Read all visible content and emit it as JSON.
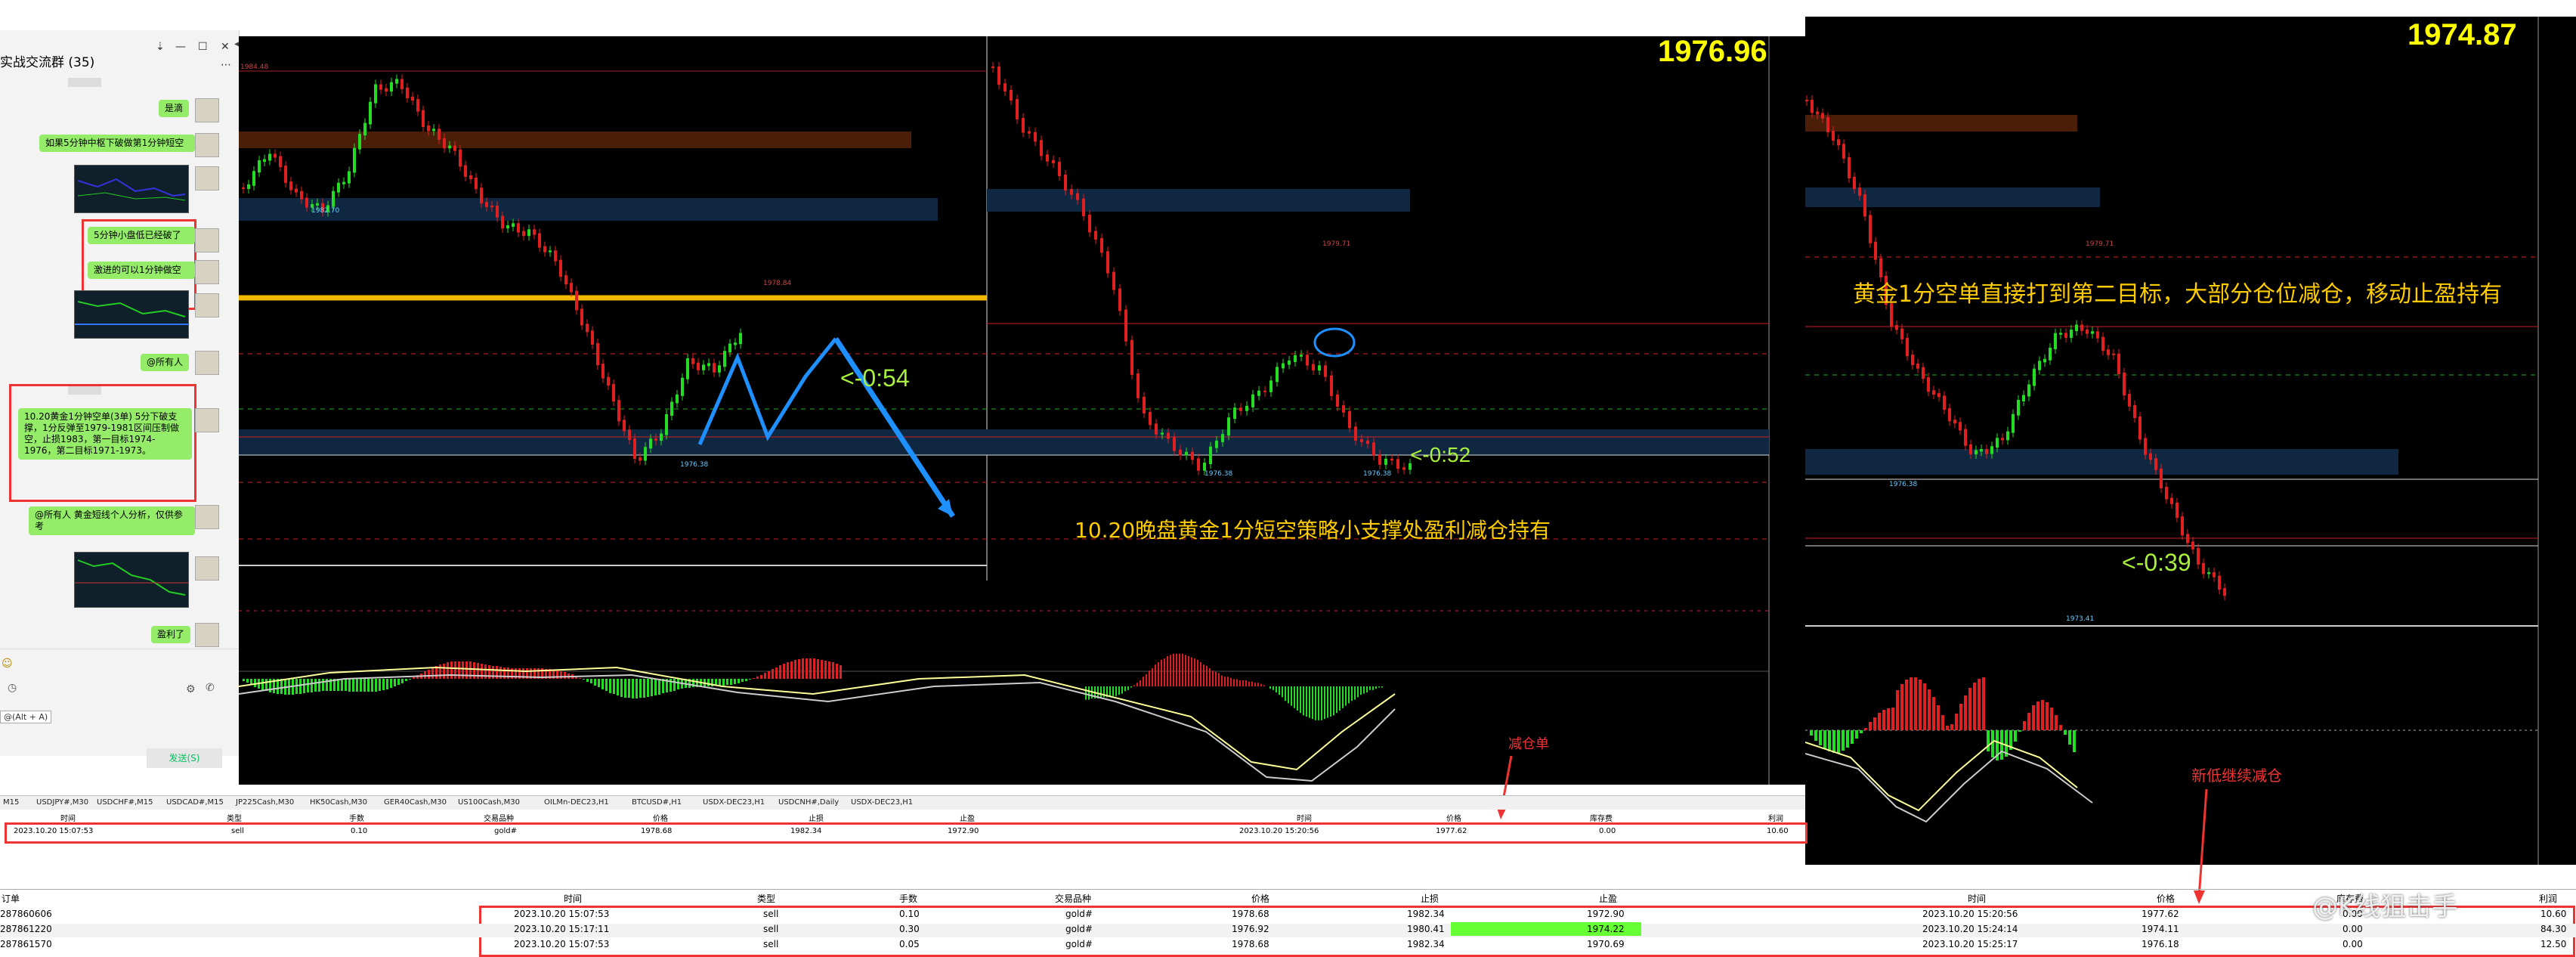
{
  "chat": {
    "title": "实战交流群 (35)",
    "messages": [
      {
        "text": "是滴"
      },
      {
        "text": "如果5分钟中枢下破做第1分钟短空"
      },
      {
        "text": "5分钟小盘低已经破了"
      },
      {
        "text": "激进的可以1分钟做空"
      },
      {
        "text": "@所有人"
      },
      {
        "text": "10.20黄金1分钟空单(3单) 5分下破支撑，1分反弹至1979-1981区间压制做空，止损1983，第一目标1974-1976，第二目标1971-1973。"
      },
      {
        "text": "@所有人 黄金短线个人分析，仅供参考"
      },
      {
        "text": "盈利了"
      }
    ],
    "input_hint": "@(Alt + A)",
    "send_label": "发送(S)"
  },
  "charts": {
    "price_mid": "1976.96",
    "price_right": "1974.87",
    "label_left_a": "1984.48",
    "label_left_b": "1982.70",
    "label_left_c": "1978.84",
    "label_left_d": "1976.38",
    "label_mid_a": "1979.71",
    "label_mid_b": "1976.38",
    "label_mid_c": "1976.38",
    "label_right_a": "1979.71",
    "label_right_b": "1976.38",
    "label_right_c": "1973.41"
  },
  "annotations": {
    "pnl_left": "<-0:54",
    "pnl_mid": "<-0:52",
    "pnl_right": "<-0:39",
    "strategy_note": "10.20晚盘黄金1分短空策略小支撑处盈利减仓持有",
    "target_note": "黄金1分空单直接打到第二目标，大部分仓位减仓，移动止盈持有",
    "reduce_label": "减仓单",
    "new_low_label": "新低继续减仓"
  },
  "symbol_tabs": [
    "M15",
    "USDJPY#,M30",
    "USDCHF#,M15",
    "USDCAD#,M15",
    "JP225Cash,M30",
    "HK50Cash,M30",
    "GER40Cash,M30",
    "US100Cash,M30",
    "OILMn-DEC23,H1",
    "BTCUSD#,H1",
    "USDX-DEC23,H1",
    "USDCNH#,Daily",
    "USDX-DEC23,H1"
  ],
  "upper_table": {
    "headers": [
      "时间",
      "类型",
      "手数",
      "交易品种",
      "价格",
      "止损",
      "止盈",
      "时间",
      "价格",
      "库存费",
      "利润"
    ],
    "row": [
      "2023.10.20 15:07:53",
      "sell",
      "0.10",
      "gold#",
      "1978.68",
      "1982.34",
      "1972.90",
      "2023.10.20 15:20:56",
      "1977.62",
      "0.00",
      "10.60"
    ]
  },
  "lower_table": {
    "headers": [
      "订单",
      "时间",
      "类型",
      "手数",
      "交易品种",
      "价格",
      "止损",
      "止盈",
      "时间",
      "价格",
      "库存费",
      "利润"
    ],
    "rows": [
      [
        "287860606",
        "2023.10.20 15:07:53",
        "sell",
        "0.10",
        "gold#",
        "1978.68",
        "1982.34",
        "1972.90",
        "2023.10.20 15:20:56",
        "1977.62",
        "0.00",
        "10.60"
      ],
      [
        "287861220",
        "2023.10.20 15:17:11",
        "sell",
        "0.30",
        "gold#",
        "1976.92",
        "1980.41",
        "1974.22",
        "2023.10.20 15:24:14",
        "1974.11",
        "0.00",
        "84.30"
      ],
      [
        "287861570",
        "2023.10.20 15:07:53",
        "sell",
        "0.05",
        "gold#",
        "1978.68",
        "1982.34",
        "1970.69",
        "2023.10.20 15:25:17",
        "1976.18",
        "0.00",
        "12.50"
      ]
    ]
  },
  "watermark": "@K线狙击手",
  "colors": {
    "bull": "#22dd22",
    "bear": "#e02020",
    "gold_line": "#f5b800",
    "resist_zone": "#4a1e08",
    "support_zone": "#0f2740",
    "highlight": "#66ff33"
  }
}
